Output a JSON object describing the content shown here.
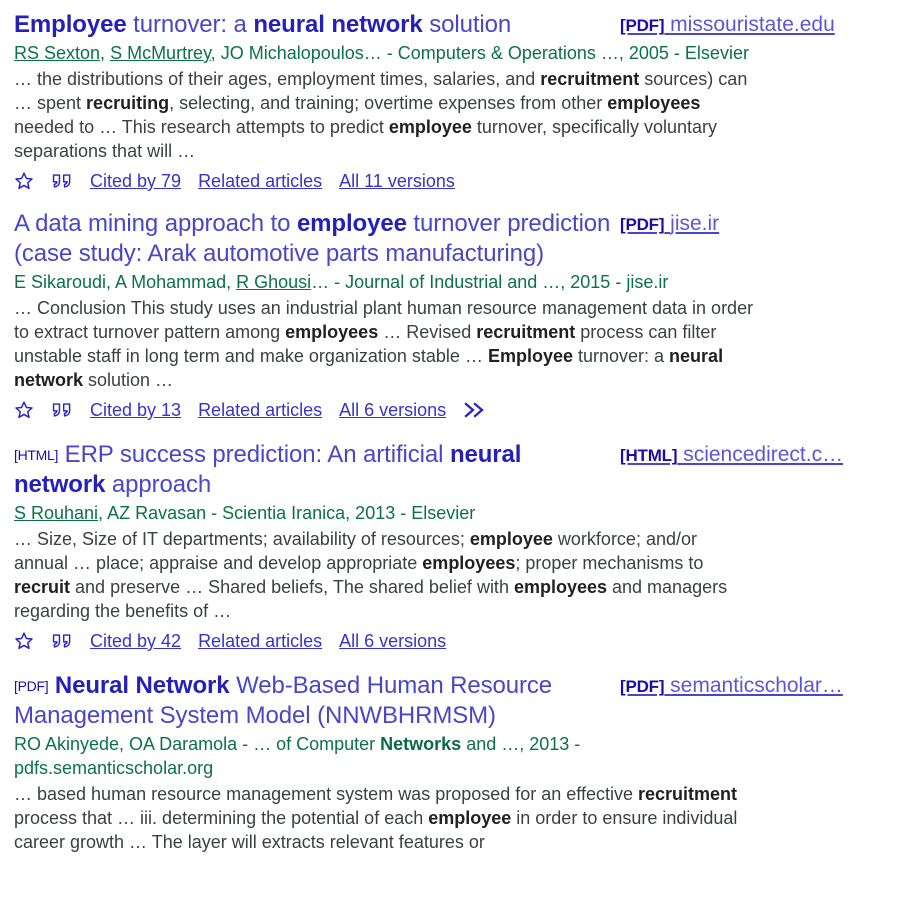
{
  "colors": {
    "title_link": "#4a46c8",
    "title_bold": "#2521b8",
    "tag_blue": "#1a0dab",
    "author_green": "#0b7247",
    "snippet_gray": "#3c4043",
    "action_blue": "#3733c9",
    "background": "#ffffff"
  },
  "icons": {
    "save_star": "star-icon",
    "cite_quote": "quote-icon",
    "more_chevrons": "double-chevron-icon"
  },
  "results": [
    {
      "title_parts": [
        {
          "text": "Employee",
          "bold": true
        },
        {
          "text": " turnover: a ",
          "bold": false
        },
        {
          "text": "neural network",
          "bold": true
        },
        {
          "text": " solution",
          "bold": false
        }
      ],
      "title_prefix": "",
      "resource": {
        "tag": "[PDF]",
        "domain": "missouristate.edu"
      },
      "authors_parts": [
        {
          "text": "RS Sexton",
          "link": true
        },
        {
          "text": ", ",
          "link": false
        },
        {
          "text": "S McMurtrey",
          "link": true
        },
        {
          "text": ", JO Michalopoulos… - Computers & Operations …, 2005 - Elsevier",
          "link": false
        }
      ],
      "snippet_parts": [
        {
          "text": "… the distributions of their ages, employment times, salaries, and ",
          "bold": false
        },
        {
          "text": "recruitment",
          "bold": true
        },
        {
          "text": " sources) can … spent ",
          "bold": false
        },
        {
          "text": "recruiting",
          "bold": true
        },
        {
          "text": ", selecting, and training; overtime expenses from other ",
          "bold": false
        },
        {
          "text": "employees",
          "bold": true
        },
        {
          "text": " needed to … This research attempts to predict ",
          "bold": false
        },
        {
          "text": "employee",
          "bold": true
        },
        {
          "text": " turnover, specifically voluntary separations that will …",
          "bold": false
        }
      ],
      "actions": {
        "cited_by": "Cited by 79",
        "related": "Related articles",
        "versions": "All 11 versions",
        "has_more": false
      }
    },
    {
      "title_parts": [
        {
          "text": "A data mining approach to ",
          "bold": false
        },
        {
          "text": "employee",
          "bold": true
        },
        {
          "text": " turnover prediction (case study: Arak automotive parts manufacturing)",
          "bold": false
        }
      ],
      "title_prefix": "",
      "resource": {
        "tag": "[PDF]",
        "domain": "jise.ir"
      },
      "authors_parts": [
        {
          "text": "E Sikaroudi, A Mohammad, ",
          "link": false
        },
        {
          "text": "R Ghousi",
          "link": true
        },
        {
          "text": "… - Journal of Industrial and …, 2015 - jise.ir",
          "link": false
        }
      ],
      "snippet_parts": [
        {
          "text": "… Conclusion This study uses an industrial plant human resource management data in order to extract turnover pattern among ",
          "bold": false
        },
        {
          "text": "employees",
          "bold": true
        },
        {
          "text": " … Revised ",
          "bold": false
        },
        {
          "text": "recruitment",
          "bold": true
        },
        {
          "text": " process can filter unstable staff in long term and make organization stable … ",
          "bold": false
        },
        {
          "text": "Employee",
          "bold": true
        },
        {
          "text": " turnover: a ",
          "bold": false
        },
        {
          "text": "neural network",
          "bold": true
        },
        {
          "text": " solution …",
          "bold": false
        }
      ],
      "actions": {
        "cited_by": "Cited by 13",
        "related": "Related articles",
        "versions": "All 6 versions",
        "has_more": true
      }
    },
    {
      "title_parts": [
        {
          "text": "ERP success prediction: An artificial ",
          "bold": false
        },
        {
          "text": "neural network",
          "bold": true
        },
        {
          "text": " approach",
          "bold": false
        }
      ],
      "title_prefix": "[HTML]",
      "resource": {
        "tag": "[HTML]",
        "domain": "sciencedirect.c…"
      },
      "authors_parts": [
        {
          "text": "S Rouhani",
          "link": true
        },
        {
          "text": ", AZ Ravasan - Scientia Iranica, 2013 - Elsevier",
          "link": false
        }
      ],
      "snippet_parts": [
        {
          "text": "… Size, Size of IT departments; availability of resources; ",
          "bold": false
        },
        {
          "text": "employee",
          "bold": true
        },
        {
          "text": " workforce; and/or annual … place; appraise and develop appropriate ",
          "bold": false
        },
        {
          "text": "employees",
          "bold": true
        },
        {
          "text": "; proper mechanisms to ",
          "bold": false
        },
        {
          "text": "recruit",
          "bold": true
        },
        {
          "text": " and preserve … Shared beliefs, The shared belief with ",
          "bold": false
        },
        {
          "text": "employees",
          "bold": true
        },
        {
          "text": " and managers regarding the benefits of …",
          "bold": false
        }
      ],
      "actions": {
        "cited_by": "Cited by 42",
        "related": "Related articles",
        "versions": "All 6 versions",
        "has_more": false
      }
    },
    {
      "title_parts": [
        {
          "text": "Neural Network",
          "bold": true
        },
        {
          "text": " Web-Based Human Resource Management System Model (NNWBHRMSM)",
          "bold": false
        }
      ],
      "title_prefix": "[PDF]",
      "resource": {
        "tag": "[PDF]",
        "domain": "semanticscholar…"
      },
      "authors_parts": [
        {
          "text": "RO Akinyede, OA Daramola - … of Computer ",
          "link": false,
          "bold": false
        },
        {
          "text": "Networks",
          "link": false,
          "bold": true
        },
        {
          "text": " and …, 2013 - pdfs.semanticscholar.org",
          "link": false,
          "bold": false
        }
      ],
      "snippet_parts": [
        {
          "text": "… based human resource management system was proposed for an effective ",
          "bold": false
        },
        {
          "text": "recruitment",
          "bold": true
        },
        {
          "text": " process that … iii. determining the potential of each ",
          "bold": false
        },
        {
          "text": "employee",
          "bold": true
        },
        {
          "text": " in order to ensure individual career growth … The layer will extracts relevant features or",
          "bold": false
        }
      ],
      "actions": null
    }
  ]
}
